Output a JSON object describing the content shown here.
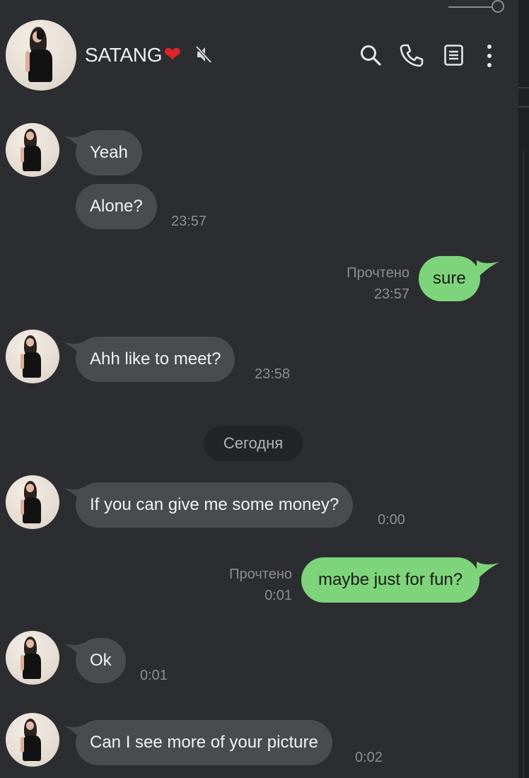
{
  "contact": {
    "name": "SATANG",
    "heart_emoji": "❤",
    "muted": true
  },
  "header_icons": [
    "search-icon",
    "phone-icon",
    "notes-icon",
    "more-icon"
  ],
  "date_divider": "Сегодня",
  "messages": [
    {
      "dir": "in",
      "text": "Yeah"
    },
    {
      "dir": "in",
      "text": "Alone?",
      "time": "23:57"
    },
    {
      "dir": "out",
      "text": "sure",
      "read": "Прочтено",
      "time": "23:57"
    },
    {
      "dir": "in",
      "text": "Ahh like to meet?",
      "time": "23:58"
    },
    {
      "dir": "in",
      "text": "If you can give me some money?",
      "time": "0:00"
    },
    {
      "dir": "out",
      "text": "maybe just for fun?",
      "read": "Прочтено",
      "time": "0:01"
    },
    {
      "dir": "in",
      "text": "Ok",
      "time": "0:01"
    },
    {
      "dir": "in",
      "text": "Can I see more of your picture",
      "time": "0:02"
    }
  ],
  "colors": {
    "background": "#2c2d30",
    "incoming_bubble": "#4a4b4e",
    "outgoing_bubble": "#7ed47a",
    "meta_text": "#8c8d90"
  }
}
